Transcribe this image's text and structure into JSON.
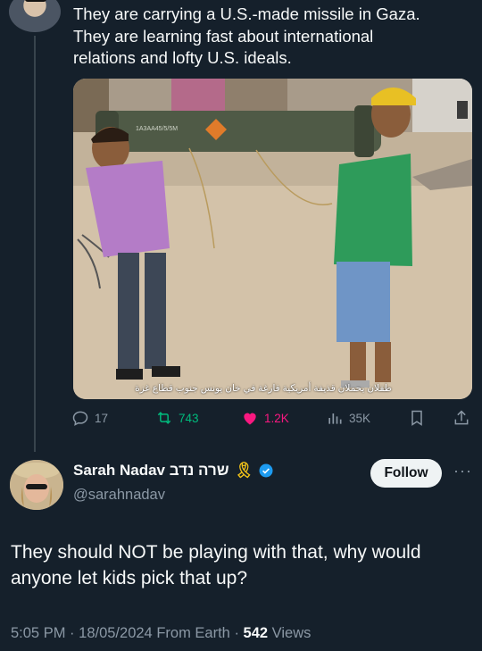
{
  "tweet": {
    "lines": [
      "They are carrying a U.S.-made missile in Gaza.",
      "They are learning fast about international",
      "relations and lofty U.S. ideals."
    ],
    "media": {
      "caption": "طفلان يحملان قذيفة أمريكية فارغة في خان يونس جنوب قطاع غزة",
      "launcher_label": "1A3AA45/5/5M"
    },
    "actions": {
      "replies": "17",
      "reposts": "743",
      "likes": "1.2K",
      "views": "35K"
    },
    "colors": {
      "repost": "#00ba7c",
      "like": "#f91880",
      "muted": "#8b98a5"
    }
  },
  "reply": {
    "display_name": "Sarah Nadav שרה נדב",
    "ribbon_icon": "yellow-ribbon",
    "handle": "@sarahnadav",
    "follow_label": "Follow",
    "more_label": "···",
    "text_lines": [
      "They should NOT be playing with that, why would",
      "anyone let kids pick that up?"
    ],
    "time": "5:05 PM",
    "date": "18/05/2024",
    "source": "From Earth",
    "views_count": "542",
    "views_label": "Views",
    "colors": {
      "verified": "#1d9bf0"
    }
  }
}
